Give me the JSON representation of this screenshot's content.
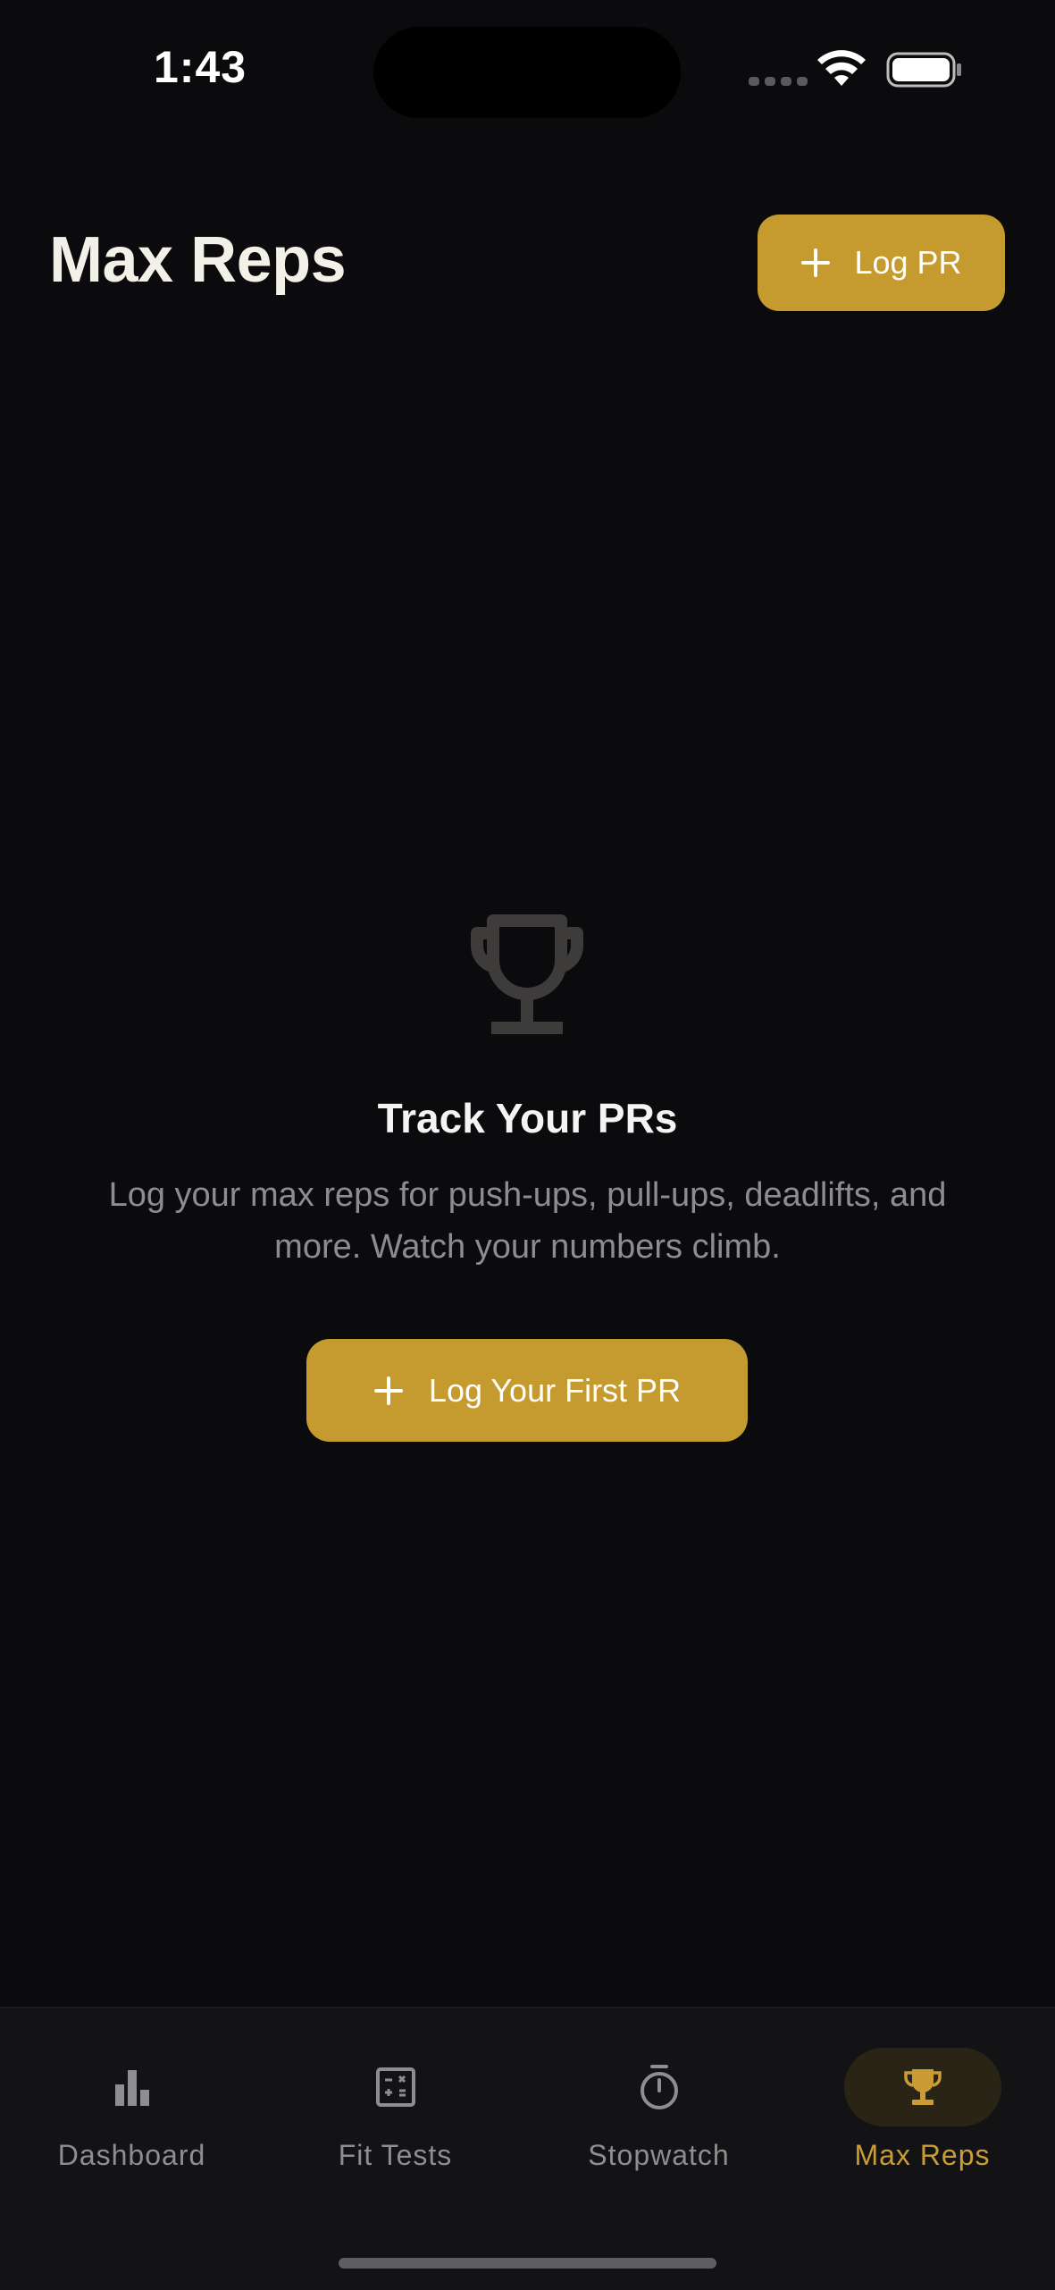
{
  "status_bar": {
    "time": "1:43"
  },
  "header": {
    "title": "Max Reps",
    "log_pr_button": {
      "icon": "plus-icon",
      "label": "Log PR"
    }
  },
  "empty_state": {
    "icon": "trophy-icon",
    "title": "Track Your PRs",
    "description": "Log your max reps for push-ups, pull-ups, deadlifts, and more. Watch your numbers climb.",
    "cta": {
      "icon": "plus-icon",
      "label": "Log Your First PR"
    }
  },
  "tabs": [
    {
      "label": "Dashboard",
      "icon": "bar-chart-icon",
      "active": false
    },
    {
      "label": "Fit Tests",
      "icon": "calculator-icon",
      "active": false
    },
    {
      "label": "Stopwatch",
      "icon": "stopwatch-icon",
      "active": false
    },
    {
      "label": "Max Reps",
      "icon": "trophy-icon",
      "active": true
    }
  ],
  "colors": {
    "background": "#0b0b0d",
    "accent": "#c59a2f",
    "active_tab": "#c99d33",
    "inactive_tab": "#8e8e90",
    "tab_bar": "#131315"
  }
}
